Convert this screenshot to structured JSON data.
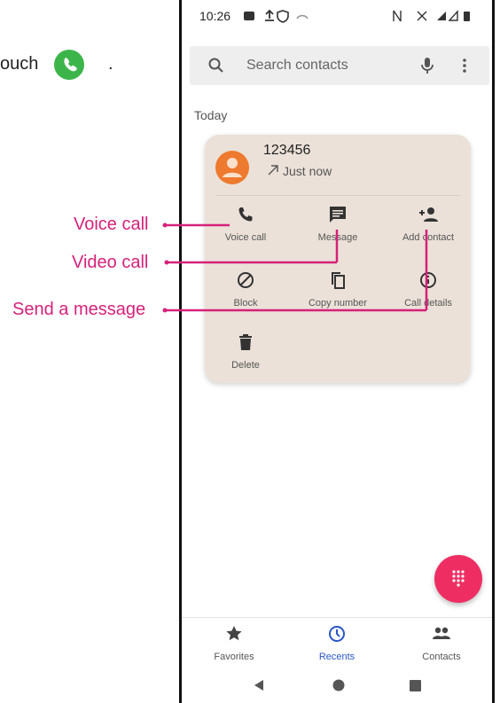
{
  "instruction": {
    "text": "ouch",
    "trailing": "."
  },
  "annotations": {
    "voice_call": "Voice call",
    "video_call": "Video call",
    "send_message": "Send a message"
  },
  "status_bar": {
    "time": "10:26"
  },
  "search": {
    "placeholder": "Search contacts",
    "icon": "search-icon",
    "mic_icon": "mic-icon",
    "menu_icon": "more-vert-icon"
  },
  "section_header": "Today",
  "contact_card": {
    "name": "123456",
    "call_time": "Just now",
    "call_direction_icon": "outgoing-arrow-icon",
    "actions": [
      {
        "label": "Voice call",
        "icon": "phone-icon"
      },
      {
        "label": "Message",
        "icon": "message-icon"
      },
      {
        "label": "Add contact",
        "icon": "add-person-icon"
      },
      {
        "label": "Block",
        "icon": "block-icon"
      },
      {
        "label": "Copy number",
        "icon": "copy-icon"
      },
      {
        "label": "Call details",
        "icon": "info-icon"
      },
      {
        "label": "Delete",
        "icon": "delete-icon"
      }
    ]
  },
  "bottom_nav": {
    "tabs": [
      {
        "label": "Favorites",
        "icon": "star-icon"
      },
      {
        "label": "Recents",
        "icon": "clock-icon",
        "active": true
      },
      {
        "label": "Contacts",
        "icon": "people-icon"
      }
    ]
  },
  "colors": {
    "accent": "#ee2e63",
    "annotation": "#d6217a",
    "active_tab": "#2a56c6",
    "card_bg": "#ebe1d8",
    "avatar": "#ee7a2f",
    "phone_green": "#3bb54a"
  }
}
